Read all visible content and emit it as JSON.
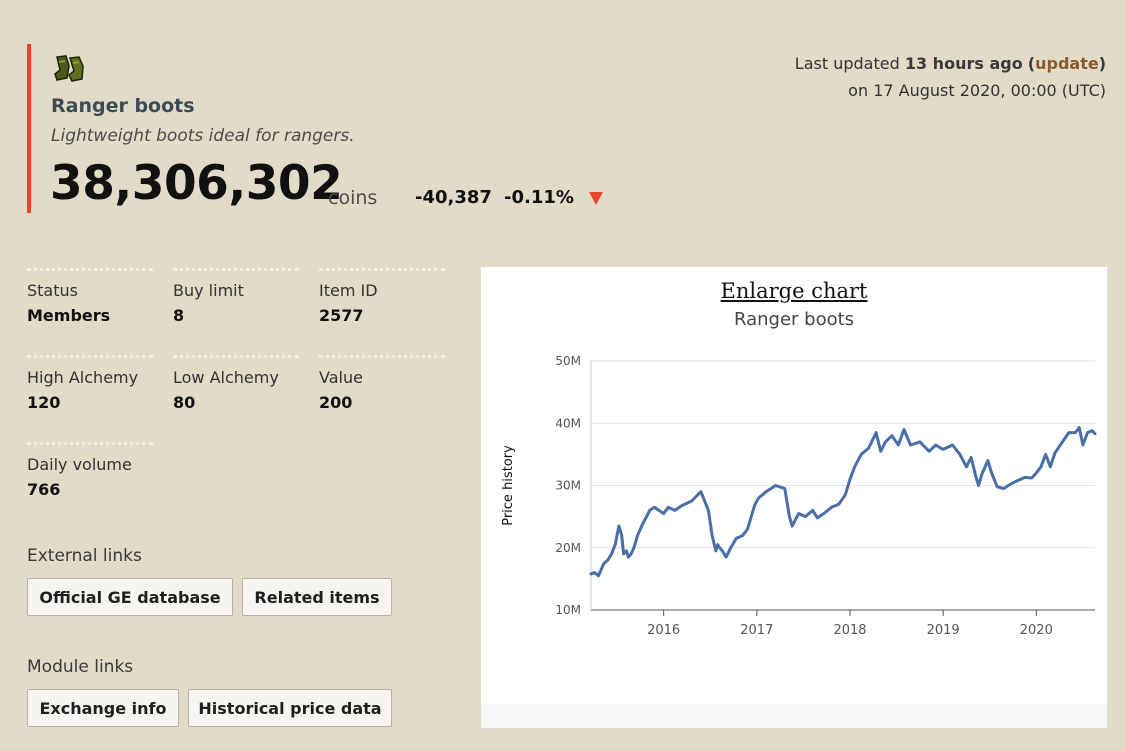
{
  "item": {
    "name": "Ranger boots",
    "description": "Lightweight boots ideal for rangers.",
    "price": "38,306,302",
    "price_unit": "coins",
    "change": "-40,387",
    "change_pct": "-0.11%",
    "icon": "ranger-boots-icon"
  },
  "updated": {
    "prefix": "Last updated",
    "ago": "13 hours ago",
    "link_open": "(",
    "link_label": "update",
    "link_close": ")",
    "date": "on 17 August 2020, 00:00 (UTC)"
  },
  "info": {
    "status_label": "Status",
    "status_value": "Members",
    "buylimit_label": "Buy limit",
    "buylimit_value": "8",
    "itemid_label": "Item ID",
    "itemid_value": "2577",
    "highalch_label": "High Alchemy",
    "highalch_value": "120",
    "lowalch_label": "Low Alchemy",
    "lowalch_value": "80",
    "value_label": "Value",
    "value_value": "200",
    "volume_label": "Daily volume",
    "volume_value": "766"
  },
  "external_links": {
    "label": "External links",
    "official_ge": "Official GE database",
    "related": "Related items"
  },
  "module_links": {
    "label": "Module links",
    "exchange_info": "Exchange info",
    "historical": "Historical price data"
  },
  "chart": {
    "enlarge_label": "Enlarge chart"
  },
  "colors": {
    "accent_red": "#e8452c",
    "line_blue": "#4a6ea5",
    "background": "#e2dbc8"
  },
  "chart_data": {
    "type": "line",
    "title": "Ranger boots",
    "xlabel": "",
    "ylabel": "Price history",
    "ylim": [
      10,
      50
    ],
    "y_unit": "M",
    "yticks": [
      "10M",
      "20M",
      "30M",
      "40M",
      "50M"
    ],
    "xlim": [
      2015.22,
      2020.63
    ],
    "xticks": [
      "2016",
      "2017",
      "2018",
      "2019",
      "2020"
    ],
    "grid": true,
    "series": [
      {
        "x": [
          2015.22,
          2015.26,
          2015.3,
          2015.33,
          2015.36,
          2015.4,
          2015.44,
          2015.48,
          2015.52,
          2015.55,
          2015.57,
          2015.6,
          2015.62,
          2015.65,
          2015.68,
          2015.72,
          2015.78,
          2015.85,
          2015.9,
          2015.95,
          2016.0,
          2016.05,
          2016.12,
          2016.2,
          2016.3,
          2016.4,
          2016.48,
          2016.52,
          2016.56,
          2016.58,
          2016.6,
          2016.63,
          2016.67,
          2016.72,
          2016.78,
          2016.85,
          2016.9,
          2016.95,
          2016.98,
          2017.02,
          2017.1,
          2017.2,
          2017.3,
          2017.35,
          2017.38,
          2017.45,
          2017.52,
          2017.6,
          2017.65,
          2017.72,
          2017.8,
          2017.88,
          2017.95,
          2018.0,
          2018.05,
          2018.12,
          2018.2,
          2018.28,
          2018.33,
          2018.38,
          2018.45,
          2018.52,
          2018.58,
          2018.65,
          2018.75,
          2018.85,
          2018.92,
          2019.0,
          2019.1,
          2019.18,
          2019.25,
          2019.3,
          2019.35,
          2019.38,
          2019.42,
          2019.48,
          2019.52,
          2019.58,
          2019.65,
          2019.72,
          2019.8,
          2019.88,
          2019.95,
          2020.0,
          2020.05,
          2020.1,
          2020.15,
          2020.2,
          2020.28,
          2020.35,
          2020.42,
          2020.46,
          2020.5,
          2020.55,
          2020.6,
          2020.63
        ],
        "values": [
          15.8,
          16.0,
          15.5,
          16.5,
          17.5,
          18.0,
          19.0,
          20.5,
          23.5,
          22.0,
          19.0,
          19.5,
          18.5,
          19.0,
          20.0,
          22.0,
          24.0,
          26.0,
          26.5,
          26.0,
          25.5,
          26.5,
          26.0,
          26.8,
          27.5,
          29.0,
          26.0,
          22.0,
          19.5,
          20.5,
          20.0,
          19.5,
          18.5,
          20.0,
          21.5,
          22.0,
          23.0,
          25.5,
          27.0,
          28.0,
          29.0,
          30.0,
          29.5,
          25.0,
          23.5,
          25.5,
          25.0,
          26.0,
          24.8,
          25.5,
          26.5,
          27.0,
          28.5,
          31.0,
          33.0,
          35.0,
          36.0,
          38.5,
          35.5,
          37.0,
          38.0,
          36.5,
          39.0,
          36.5,
          37.0,
          35.5,
          36.5,
          35.8,
          36.5,
          35.0,
          33.0,
          34.5,
          31.5,
          30.0,
          32.0,
          34.0,
          32.0,
          29.8,
          29.5,
          30.2,
          30.8,
          31.3,
          31.2,
          32.0,
          33.0,
          35.0,
          33.0,
          35.2,
          37.0,
          38.5,
          38.5,
          39.3,
          36.5,
          38.5,
          38.8,
          38.3
        ]
      }
    ]
  }
}
